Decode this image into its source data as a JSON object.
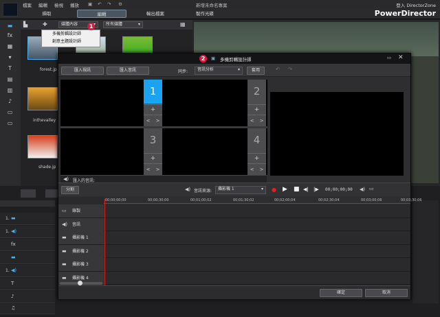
{
  "menubar": {
    "items": [
      "檔案",
      "編輯",
      "檢視",
      "播放"
    ],
    "title": "新增未命名專案"
  },
  "tabs": [
    {
      "label": "擷取"
    },
    {
      "label": "編輯"
    },
    {
      "label": "輸出檔案"
    },
    {
      "label": "製作光碟"
    }
  ],
  "brand": {
    "app_name": "PowerDirector",
    "login_text": "登入 DirectorZone"
  },
  "library": {
    "filter1": "媒體內容",
    "filter2": "所有媒體",
    "items": [
      {
        "name": "forest.jp"
      },
      {
        "name": "inthevalley"
      },
      {
        "name": "shade.jp"
      }
    ]
  },
  "popup_menu": {
    "items": [
      "多機剪輯設計師",
      "創意主題設計師"
    ]
  },
  "badges": {
    "one": "1",
    "two": "2"
  },
  "dialog": {
    "title": "多機剪輯設計師",
    "import_video": "匯入視訊",
    "import_audio": "匯入音訊",
    "sync_label": "同步:",
    "sync_value": "音訊分析",
    "apply": "套用",
    "cells": [
      {
        "num": "1"
      },
      {
        "num": "2"
      },
      {
        "num": "3"
      },
      {
        "num": "4"
      }
    ],
    "imported_audio": "匯入的音訊:",
    "split": "分割",
    "audio_source_label": "音訊來源:",
    "audio_source_value": "攝影機 1",
    "timecode": "00;00;00;00",
    "ruler": [
      "00;00;00;00",
      "00;00;30;00",
      "00;01;00;02",
      "00;01;30;02",
      "00;02;00;04",
      "00;02;30;04",
      "00;03;00;06",
      "00;03;30;06"
    ],
    "tracks": [
      "錄製",
      "音訊",
      "攝影機 1",
      "攝影機 2",
      "攝影機 3",
      "攝影機 4"
    ],
    "ok": "確定",
    "cancel": "取消"
  },
  "main_track_nums": [
    "1.",
    "1.",
    "",
    "",
    "1.",
    "",
    ""
  ],
  "colors": {
    "accent": "#1aa3f0",
    "badge": "#e0183c",
    "record": "#e02020"
  }
}
